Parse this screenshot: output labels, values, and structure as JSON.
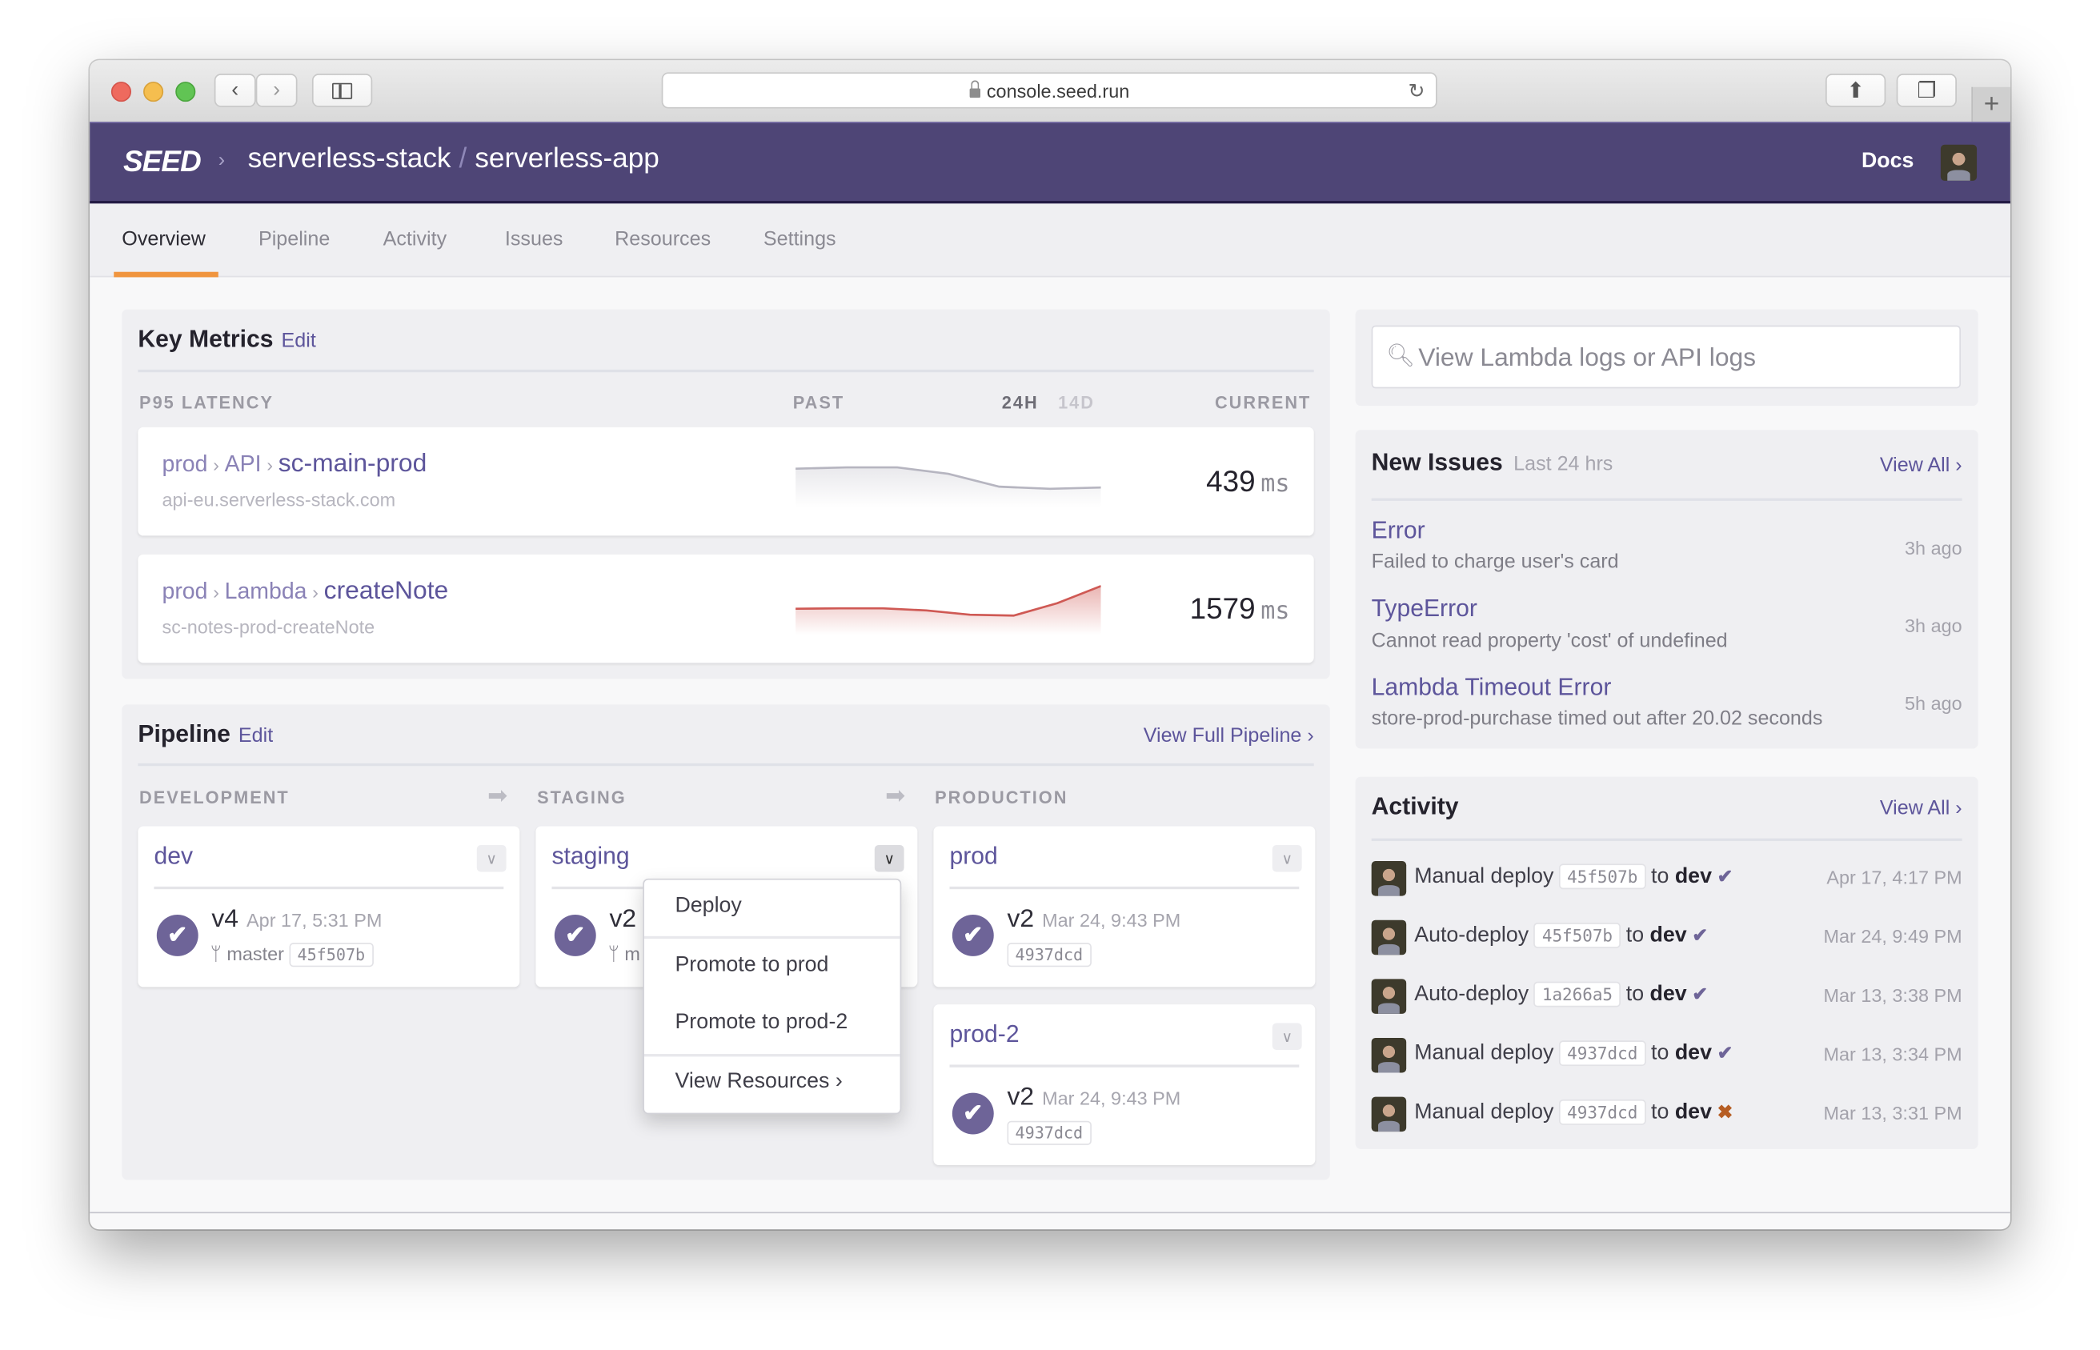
{
  "browser": {
    "url": "console.seed.run",
    "new_tab_label": "+"
  },
  "header": {
    "logo": "SEED",
    "breadcrumb_sep": "›",
    "org": "serverless-stack",
    "slash": "/",
    "app": "serverless-app",
    "docs_label": "Docs"
  },
  "tabs": [
    {
      "label": "Overview",
      "active": true
    },
    {
      "label": "Pipeline"
    },
    {
      "label": "Activity"
    },
    {
      "label": "Issues"
    },
    {
      "label": "Resources"
    },
    {
      "label": "Settings"
    }
  ],
  "key_metrics": {
    "title": "Key Metrics",
    "edit_label": "Edit",
    "col_latency": "P95 LATENCY",
    "col_past": "PAST",
    "range_24h": "24H",
    "range_14d": "14D",
    "range_selected": "24H",
    "col_current": "CURRENT",
    "rows": [
      {
        "stage": "prod",
        "type": "API",
        "name": "sc-main-prod",
        "sub": "api-eu.serverless-stack.com",
        "value": "439",
        "unit": "ms",
        "trend": [
          0.72,
          0.75,
          0.75,
          0.6,
          0.3,
          0.25,
          0.28
        ],
        "color": "#b6b5c0",
        "status": "normal"
      },
      {
        "stage": "prod",
        "type": "Lambda",
        "name": "createNote",
        "sub": "sc-notes-prod-createNote",
        "value": "1579",
        "unit": "ms",
        "trend": [
          0.42,
          0.43,
          0.43,
          0.38,
          0.28,
          0.26,
          0.55,
          0.95
        ],
        "color": "#cf5954",
        "status": "alert"
      }
    ]
  },
  "pipeline": {
    "title": "Pipeline",
    "edit_label": "Edit",
    "view_full_label": "View Full Pipeline ›",
    "columns": [
      "DEVELOPMENT",
      "STAGING",
      "PRODUCTION"
    ],
    "stages": {
      "dev": {
        "name": "dev",
        "version": "v4",
        "date": "Apr 17, 5:31 PM",
        "branch": "master",
        "sha": "45f507b"
      },
      "staging": {
        "name": "staging",
        "version": "v2",
        "branch_partial": "m"
      },
      "prod": {
        "name": "prod",
        "version": "v2",
        "date": "Mar 24, 9:43 PM",
        "sha": "4937dcd"
      },
      "prod2": {
        "name": "prod-2",
        "version": "v2",
        "date": "Mar 24, 9:43 PM",
        "sha": "4937dcd"
      }
    },
    "menu": {
      "items": [
        "Deploy",
        "Promote to prod",
        "Promote to prod-2",
        "View Resources ›"
      ]
    }
  },
  "search": {
    "placeholder": "View Lambda logs or API logs"
  },
  "issues": {
    "title": "New Issues",
    "subtitle": "Last 24 hrs",
    "view_all": "View All ›",
    "items": [
      {
        "title": "Error",
        "desc": "Failed to charge user's card",
        "age": "3h ago"
      },
      {
        "title": "TypeError",
        "desc": "Cannot read property 'cost' of undefined",
        "age": "3h ago"
      },
      {
        "title": "Lambda Timeout Error",
        "desc": "store-prod-purchase timed out after 20.02 seconds",
        "age": "5h ago"
      }
    ]
  },
  "activity": {
    "title": "Activity",
    "view_all": "View All ›",
    "to_label": "to",
    "items": [
      {
        "action": "Manual deploy",
        "sha": "45f507b",
        "stage": "dev",
        "status": "success",
        "status_icon": "✔",
        "time": "Apr 17, 4:17 PM"
      },
      {
        "action": "Auto-deploy",
        "sha": "45f507b",
        "stage": "dev",
        "status": "success",
        "status_icon": "✔",
        "time": "Mar 24, 9:49 PM"
      },
      {
        "action": "Auto-deploy",
        "sha": "1a266a5",
        "stage": "dev",
        "status": "success",
        "status_icon": "✔",
        "time": "Mar 13, 3:38 PM"
      },
      {
        "action": "Manual deploy",
        "sha": "4937dcd",
        "stage": "dev",
        "status": "success",
        "status_icon": "✔",
        "time": "Mar 13, 3:34 PM"
      },
      {
        "action": "Manual deploy",
        "sha": "4937dcd",
        "stage": "dev",
        "status": "failed",
        "status_icon": "✖",
        "time": "Mar 13, 3:31 PM"
      }
    ]
  },
  "colors": {
    "brand_header": "#4e4576",
    "accent_link": "#5d559b",
    "tab_underline": "#f0953f",
    "success": "#6e6498",
    "failure": "#b65d23",
    "alert_line": "#cf5954"
  }
}
